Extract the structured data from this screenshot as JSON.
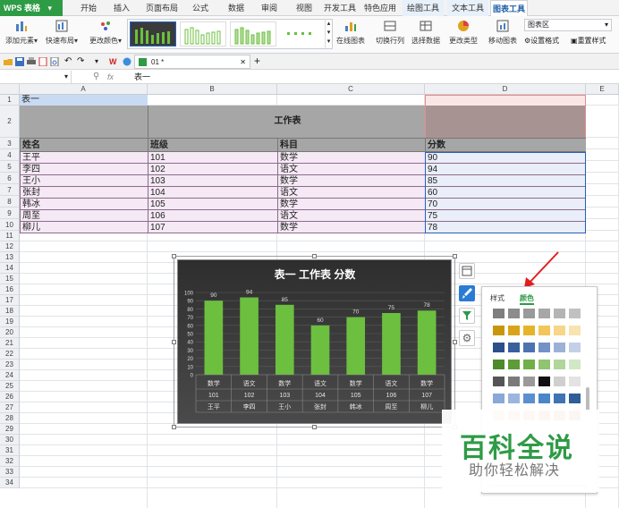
{
  "app": {
    "name": "WPS 表格"
  },
  "menu_tabs": [
    "开始",
    "插入",
    "页面布局",
    "公式",
    "数据",
    "审阅",
    "视图",
    "开发工具",
    "特色应用",
    "绘图工具",
    "文本工具",
    "图表工具"
  ],
  "active_tab": "图表工具",
  "ribbon": {
    "add_element": "添加元素",
    "quick_layout": "快速布局",
    "change_color": "更改颜色",
    "online_chart": "在线图表",
    "switch_rowcol": "切换行列",
    "select_data": "选择数据",
    "change_type": "更改类型",
    "move_chart": "移动图表",
    "chart_area_select": "图表区",
    "set_format": "设置格式",
    "reset_style": "重置样式"
  },
  "document": {
    "tab_label": "01 *"
  },
  "formula_bar": {
    "fx": "fx",
    "content": "表一"
  },
  "columns": [
    "A",
    "B",
    "C",
    "D",
    "E"
  ],
  "rows": [
    "1",
    "2",
    "3",
    "4",
    "5",
    "6",
    "7",
    "8",
    "9",
    "10",
    "11",
    "12",
    "13",
    "14",
    "15",
    "16",
    "17",
    "18",
    "19",
    "20",
    "21",
    "22",
    "23",
    "24",
    "25",
    "26",
    "27",
    "28",
    "29",
    "30",
    "31",
    "32",
    "33",
    "34"
  ],
  "sheet": {
    "a1": "表一",
    "title": "工作表",
    "headers": [
      "姓名",
      "班级",
      "科目",
      "分数"
    ],
    "data": [
      [
        "王平",
        "101",
        "数学",
        "90"
      ],
      [
        "李四",
        "102",
        "语文",
        "94"
      ],
      [
        "王小",
        "103",
        "数学",
        "85"
      ],
      [
        "张封",
        "104",
        "语文",
        "60"
      ],
      [
        "韩冰",
        "105",
        "数学",
        "70"
      ],
      [
        "周至",
        "106",
        "语文",
        "75"
      ],
      [
        "柳儿",
        "107",
        "数学",
        "78"
      ]
    ]
  },
  "chart_data": {
    "type": "bar",
    "title": "表一 工作表 分数",
    "categories": [
      [
        "数学",
        "101",
        "王平"
      ],
      [
        "语文",
        "102",
        "李四"
      ],
      [
        "数学",
        "103",
        "王小"
      ],
      [
        "语文",
        "104",
        "张封"
      ],
      [
        "数学",
        "105",
        "韩冰"
      ],
      [
        "语文",
        "106",
        "周至"
      ],
      [
        "数学",
        "107",
        "柳儿"
      ]
    ],
    "values": [
      90,
      94,
      85,
      60,
      70,
      75,
      78
    ],
    "yticks": [
      0,
      10,
      20,
      30,
      40,
      50,
      60,
      70,
      80,
      90,
      100
    ],
    "ylim": [
      0,
      100
    ],
    "bar_color": "#6cbf3f",
    "grid": true
  },
  "color_panel": {
    "tabs": [
      "样式",
      "颜色"
    ],
    "active": "颜色",
    "swatches": [
      [
        "#7f7f7f",
        "#8c8c8c",
        "#9a9a9a",
        "#a7a7a7",
        "#b4b4b4",
        "#c1c1c1"
      ],
      [
        "#c8960c",
        "#d9a41a",
        "#e6b42a",
        "#f2c65a",
        "#f6d689",
        "#f9e3b0"
      ],
      [
        "#2c4f8c",
        "#3a5f9e",
        "#4d72b0",
        "#7592c6",
        "#9db1d8",
        "#c4d0e8"
      ],
      [
        "#4e8a2c",
        "#5e9c38",
        "#70b048",
        "#90c470",
        "#b0d69c",
        "#d0e8c6"
      ],
      [
        "#555555",
        "#7a7a7a",
        "#9a9a9a",
        "#101010",
        "#cfcfcf",
        "#e3e3e3"
      ],
      [
        "#8aa8d8",
        "#9bb6de",
        "#5c8fd0",
        "#4a86c8",
        "#3f73b2",
        "#2f5e99"
      ],
      [
        "#e59460",
        "#e38a4e",
        "#e07b3a",
        "#d46c28",
        "#c75f1e",
        "#b95218"
      ]
    ]
  },
  "watermark": {
    "title": "百科全说",
    "subtitle": "助你轻松解决"
  }
}
